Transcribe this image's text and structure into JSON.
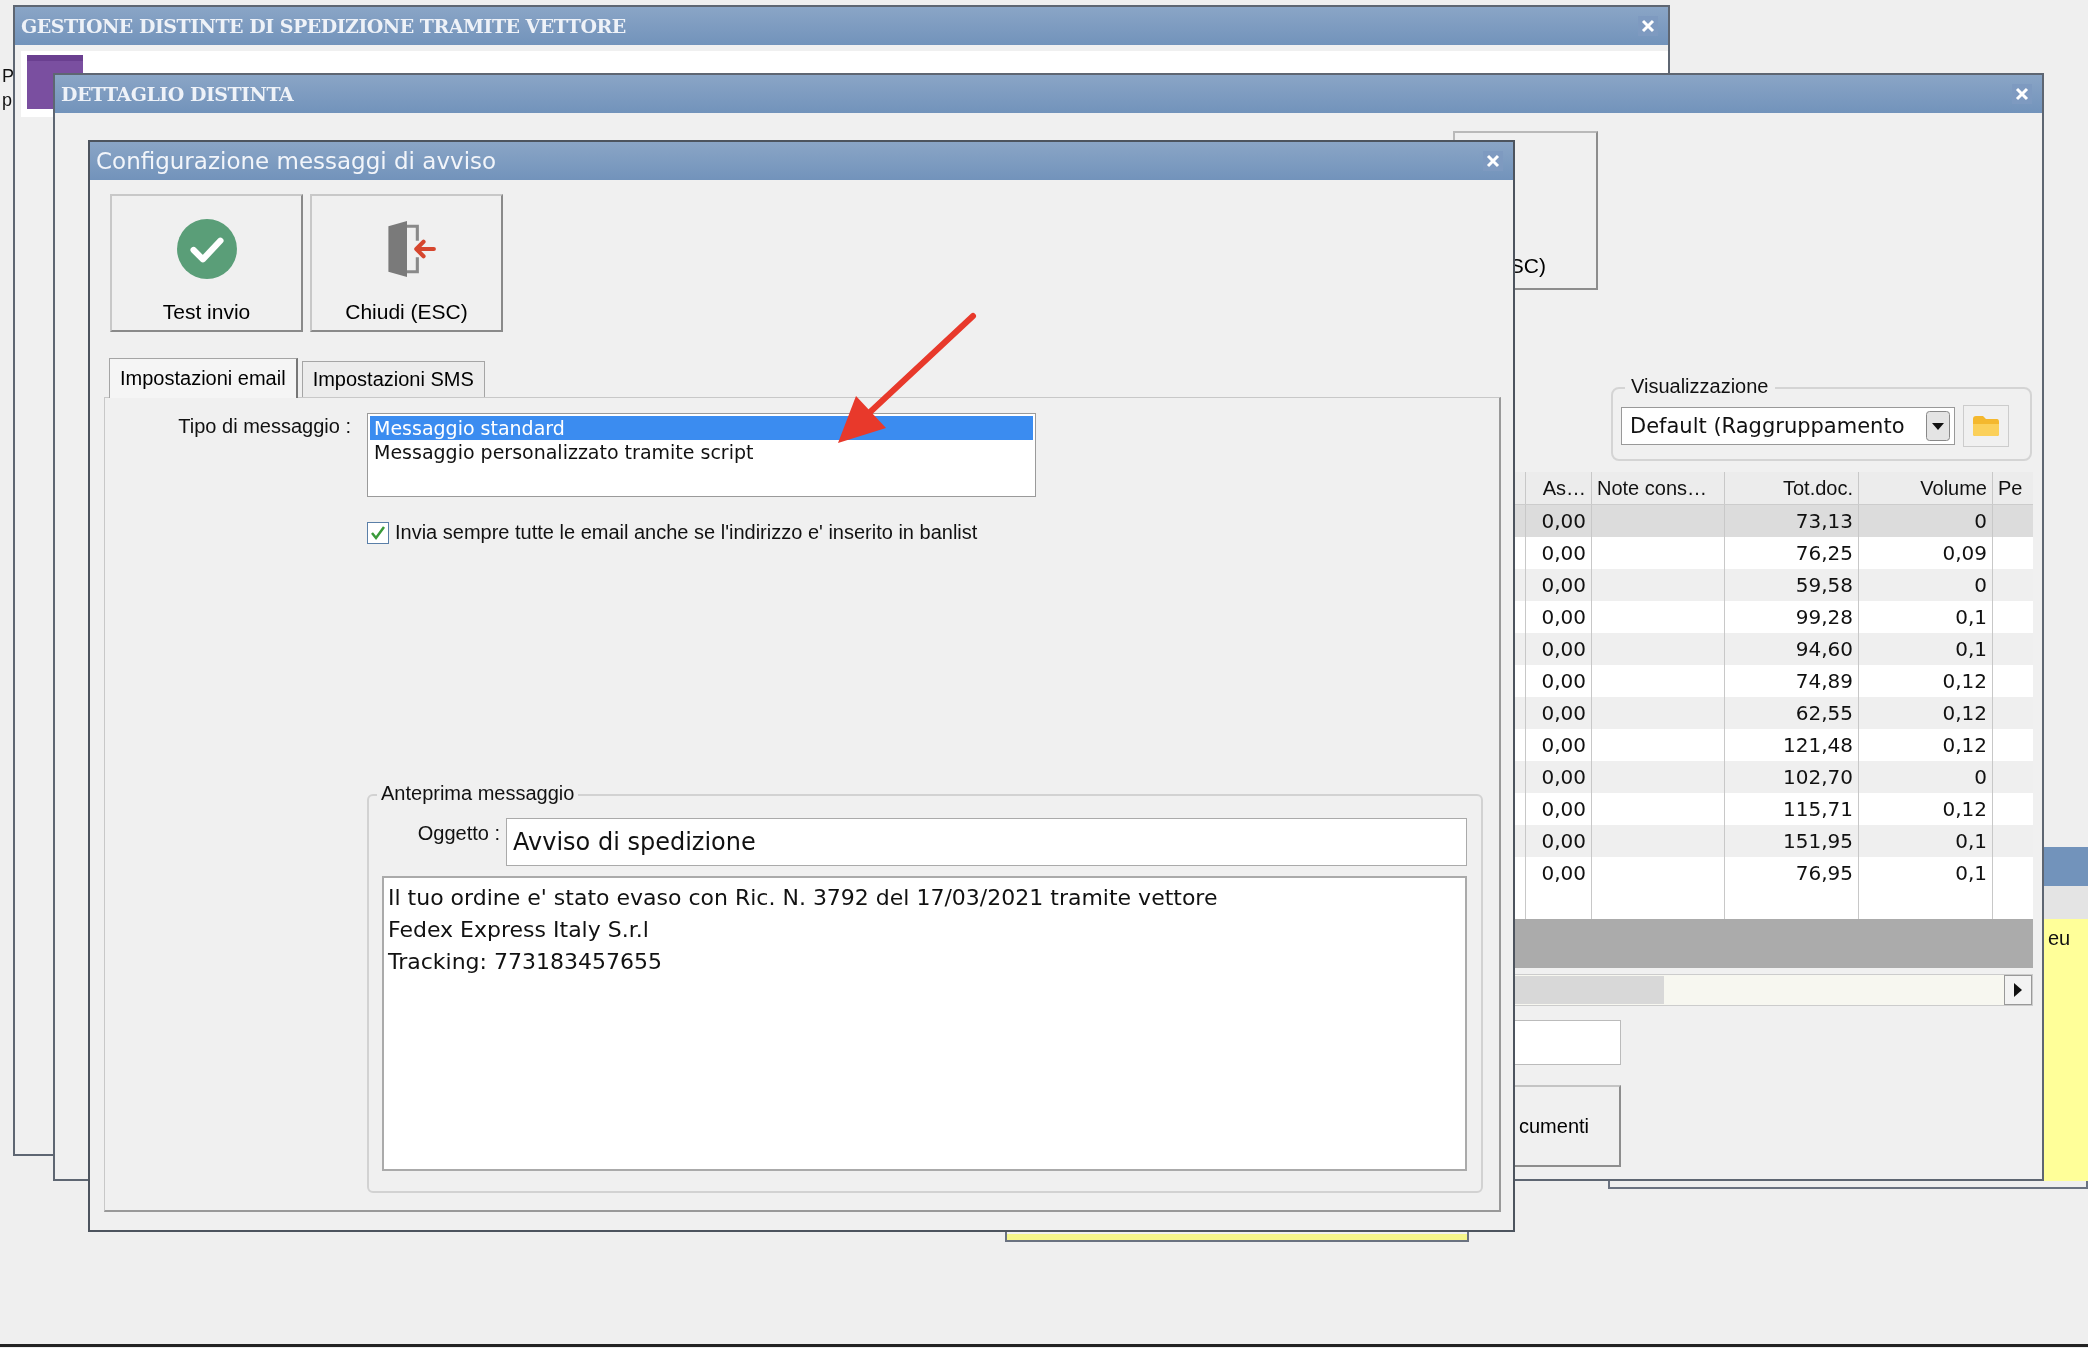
{
  "desktop": {
    "edge_letters": [
      "P",
      "p"
    ]
  },
  "back_window": {
    "title": "GESTIONE DISTINTE DI SPEDIZIONE TRAMITE VETTORE"
  },
  "detail_window": {
    "title": "DETTAGLIO DISTINTA",
    "button_fragment": "SC)",
    "view_group": {
      "legend": "Visualizzazione",
      "value": "Default (Raggruppamento"
    },
    "table": {
      "columns": [
        "As…",
        "Note cons…",
        "Tot.doc.",
        "Volume",
        "Pe"
      ],
      "rows": [
        {
          "as": "0,00",
          "tot_doc": "73,13",
          "volume": "0",
          "selected": true
        },
        {
          "as": "0,00",
          "tot_doc": "76,25",
          "volume": "0,09",
          "selected": false
        },
        {
          "as": "0,00",
          "tot_doc": "59,58",
          "volume": "0",
          "selected": false
        },
        {
          "as": "0,00",
          "tot_doc": "99,28",
          "volume": "0,1",
          "selected": false
        },
        {
          "as": "0,00",
          "tot_doc": "94,60",
          "volume": "0,1",
          "selected": false
        },
        {
          "as": "0,00",
          "tot_doc": "74,89",
          "volume": "0,12",
          "selected": false
        },
        {
          "as": "0,00",
          "tot_doc": "62,55",
          "volume": "0,12",
          "selected": false
        },
        {
          "as": "0,00",
          "tot_doc": "121,48",
          "volume": "0,12",
          "selected": false
        },
        {
          "as": "0,00",
          "tot_doc": "102,70",
          "volume": "0",
          "selected": false
        },
        {
          "as": "0,00",
          "tot_doc": "115,71",
          "volume": "0,12",
          "selected": false
        },
        {
          "as": "0,00",
          "tot_doc": "151,95",
          "volume": "0,1",
          "selected": false
        },
        {
          "as": "0,00",
          "tot_doc": "76,95",
          "volume": "0,1",
          "selected": false
        }
      ]
    },
    "bottom_button_fragment": "cumenti"
  },
  "side_panel": {
    "text": "eu"
  },
  "dialog": {
    "title": "Configurazione messaggi di avviso",
    "toolbar": [
      {
        "kind": "test",
        "label": "Test invio"
      },
      {
        "kind": "close",
        "label": "Chiudi (ESC)"
      }
    ],
    "tabs": [
      {
        "label": "Impostazioni email",
        "selected": true
      },
      {
        "label": "Impostazioni SMS",
        "selected": false
      }
    ],
    "message_type": {
      "label": "Tipo di messaggio :",
      "options": [
        {
          "label": "Messaggio standard",
          "selected": true
        },
        {
          "label": "Messaggio personalizzato tramite script",
          "selected": false
        }
      ]
    },
    "always_send": {
      "label": "Invia sempre tutte le email anche se l'indirizzo e' inserito in banlist",
      "checked": true
    },
    "preview": {
      "legend": "Anteprima messaggio",
      "subject_label": "Oggetto :",
      "subject": "Avviso di spedizione",
      "body": [
        "Il tuo ordine e' stato evaso con Ric. N. 3792 del 17/03/2021 tramite vettore",
        "Fedex Express Italy S.r.l",
        "Tracking: 773183457655"
      ]
    }
  }
}
